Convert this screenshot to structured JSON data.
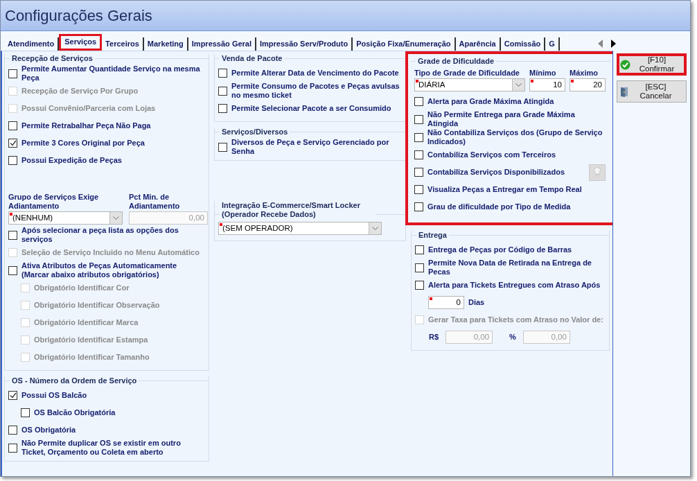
{
  "window": {
    "title": "Configurações Gerais"
  },
  "tabs": [
    {
      "label": "Atendimento",
      "selected": false,
      "highlighted": false
    },
    {
      "label": "Serviços",
      "selected": true,
      "highlighted": true
    },
    {
      "label": "Terceiros",
      "selected": false,
      "highlighted": false
    },
    {
      "label": "Marketing",
      "selected": false,
      "highlighted": false
    },
    {
      "label": "Impressão Geral",
      "selected": false,
      "highlighted": false
    },
    {
      "label": "Impressão Serv/Produto",
      "selected": false,
      "highlighted": false
    },
    {
      "label": "Posição Fixa/Enumeração",
      "selected": false,
      "highlighted": false
    },
    {
      "label": "Aparência",
      "selected": false,
      "highlighted": false
    },
    {
      "label": "Comissão",
      "selected": false,
      "highlighted": false
    },
    {
      "label": "G",
      "selected": false,
      "highlighted": false
    }
  ],
  "columns": [
    [
      {
        "title": "Recepção de Serviços",
        "items": [
          {
            "kind": "checkbox",
            "label": "Permite Aumentar Quantidade Serviço na mesma Peça",
            "checked": false,
            "disabled": false
          },
          {
            "kind": "checkbox",
            "label": "Recepção de Serviço Por Grupo",
            "checked": false,
            "disabled": true
          },
          {
            "kind": "checkbox",
            "label": "Possui Convênio/Parceria com Lojas",
            "checked": false,
            "disabled": true
          },
          {
            "kind": "checkbox",
            "label": "Permite Retrabalhar Peça Não Paga",
            "checked": false,
            "disabled": false
          },
          {
            "kind": "checkbox",
            "label": "Permite 3 Cores Original por Peça",
            "checked": true,
            "disabled": false
          },
          {
            "kind": "checkbox",
            "label": "Possui Expedição de Peças",
            "checked": false,
            "disabled": false
          },
          {
            "kind": "fields",
            "fields": [
              {
                "kind": "select",
                "label": "Grupo de Serviços Exige Adiantamento",
                "value": "(NENHUM)",
                "required": true,
                "disabled": false
              },
              {
                "kind": "number",
                "label": "Pct Min. de Adiantamento",
                "value": "0,00",
                "required": false,
                "disabled": true
              }
            ]
          },
          {
            "kind": "checkbox",
            "label": "Após selecionar a peça lista as opções dos serviços",
            "checked": false,
            "disabled": false
          },
          {
            "kind": "checkbox",
            "label": "Seleção de Serviço Incluido no Menu Automático",
            "checked": false,
            "disabled": true
          },
          {
            "kind": "checkbox",
            "label": "Ativa Atributos de Peças Automaticamente (Marcar abaixo atributos obrigatórios)",
            "checked": false,
            "disabled": false,
            "children": [
              {
                "kind": "checkbox",
                "label": "Obrigatório Identificar Cor",
                "checked": false,
                "disabled": true
              },
              {
                "kind": "checkbox",
                "label": "Obrigatório Identificar Observação",
                "checked": false,
                "disabled": true
              },
              {
                "kind": "checkbox",
                "label": "Obrigatório Identificar Marca",
                "checked": false,
                "disabled": true
              },
              {
                "kind": "checkbox",
                "label": "Obrigatório Identificar Estampa",
                "checked": false,
                "disabled": true
              },
              {
                "kind": "checkbox",
                "label": "Obrigatório Identificar Tamanho",
                "checked": false,
                "disabled": true
              }
            ]
          }
        ]
      },
      {
        "title": "OS - Número da Ordem de Serviço",
        "items": [
          {
            "kind": "checkbox",
            "label": "Possui OS Balcão",
            "checked": true,
            "disabled": false,
            "children": [
              {
                "kind": "checkbox",
                "label": "OS Balcão Obrigatória",
                "checked": false,
                "disabled": false
              }
            ]
          },
          {
            "kind": "checkbox",
            "label": "OS Obrigatória",
            "checked": false,
            "disabled": false
          },
          {
            "kind": "checkbox",
            "label": "Não Permite duplicar OS se existir em outro Ticket, Orçamento ou Coleta em aberto",
            "checked": false,
            "disabled": false
          }
        ]
      }
    ],
    [
      {
        "title": "Venda de Pacote",
        "items": [
          {
            "kind": "checkbox",
            "label": "Permite Alterar Data de Vencimento do Pacote",
            "checked": false,
            "disabled": false
          },
          {
            "kind": "checkbox",
            "label": "Permite Consumo de Pacotes  e Peças avulsas no mesmo ticket",
            "checked": false,
            "disabled": false
          },
          {
            "kind": "checkbox",
            "label": "Permite Selecionar Pacote a ser Consumido",
            "checked": false,
            "disabled": false
          }
        ]
      },
      {
        "title": "Serviços/Diversos",
        "items": [
          {
            "kind": "checkbox",
            "label": "Diversos de Peça e Serviço Gerenciado por Senha",
            "checked": false,
            "disabled": false
          }
        ]
      },
      {
        "title": "Integração E-Commerce/Smart Locker (Operador Recebe Dados)",
        "items": [
          {
            "kind": "fields",
            "fields": [
              {
                "kind": "select",
                "value": "(SEM OPERADOR)",
                "required": true,
                "disabled": false
              }
            ]
          }
        ]
      }
    ],
    [
      {
        "title": "Grade de Dificuldade",
        "highlighted": true,
        "items": [
          {
            "kind": "fields",
            "fields": [
              {
                "kind": "select",
                "label": "Tipo de Grade de Dificuldade",
                "value": "DIÁRIA",
                "required": true,
                "disabled": false
              },
              {
                "kind": "number",
                "label": "Mínimo",
                "value": "10",
                "required": true,
                "disabled": false
              },
              {
                "kind": "number",
                "label": "Máximo",
                "value": "20",
                "required": true,
                "disabled": false
              }
            ]
          },
          {
            "kind": "checkbox",
            "label": "Alerta para Grade Máxima Atingida",
            "checked": false,
            "disabled": false
          },
          {
            "kind": "checkbox",
            "label": "Não Permite Entrega para Grade Máxima Atingida",
            "checked": false,
            "disabled": false
          },
          {
            "kind": "checkbox",
            "label": "Não Contabiliza Serviços dos (Grupo de Serviço Indicados)",
            "checked": false,
            "disabled": false
          },
          {
            "kind": "checkbox",
            "label": "Contabiliza Serviços com Terceiros",
            "checked": false,
            "disabled": false
          },
          {
            "kind": "checkbox",
            "label": "Contabiliza Serviços Disponibilizados",
            "checked": false,
            "disabled": false,
            "tip": true
          },
          {
            "kind": "checkbox",
            "label": "Visualiza Peças a Entregar em Tempo Real",
            "checked": false,
            "disabled": false
          },
          {
            "kind": "checkbox",
            "label": "Grau de dificuldade por Tipo de Medida",
            "checked": false,
            "disabled": false
          }
        ]
      },
      {
        "title": "Entrega",
        "items": [
          {
            "kind": "checkbox",
            "label": "Entrega de Peças por Código de Barras",
            "checked": false,
            "disabled": false
          },
          {
            "kind": "checkbox",
            "label": "Permite Nova Data de Retirada na Entrega de Pecas",
            "checked": false,
            "disabled": false
          },
          {
            "kind": "checkbox",
            "label": "Alerta para Tickets Entregues com Atraso Após",
            "checked": false,
            "disabled": false
          },
          {
            "kind": "days",
            "value": "0",
            "unit": "Dias",
            "required": true
          },
          {
            "kind": "checkbox",
            "label": "Gerar Taxa para Tickets com Atraso no Valor de:",
            "checked": false,
            "disabled": true
          },
          {
            "kind": "amounts",
            "fields": [
              {
                "prefix": "R$",
                "value": "0,00",
                "disabled": true
              },
              {
                "prefix": "%",
                "value": "0,00",
                "disabled": true
              }
            ]
          }
        ]
      }
    ]
  ],
  "buttons": [
    {
      "kind": "confirm",
      "key": "[F10]",
      "label": "Confirmar",
      "highlighted": true
    },
    {
      "kind": "cancel",
      "key": "[ESC]",
      "label": "Cancelar"
    }
  ]
}
